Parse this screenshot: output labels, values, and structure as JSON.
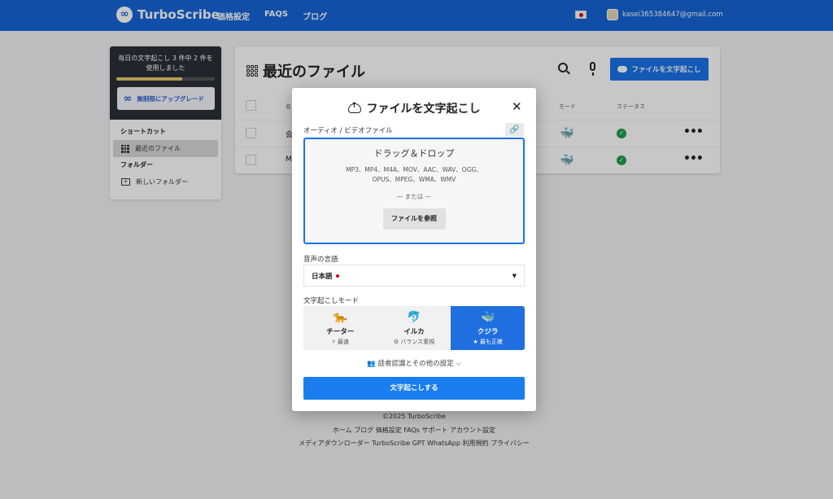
{
  "nav": {
    "brand": "TurboScribe",
    "links": [
      "価格設定",
      "FAQS",
      "ブログ"
    ],
    "email": "kasei365384647@gmail.com"
  },
  "sidebar": {
    "usage_text": "毎日の文字起こし 3 件中 2 件を使用しました",
    "usage_fraction": 0.667,
    "upgrade_label": "無制限にアップグレード",
    "shortcuts_heading": "ショートカット",
    "recent_files": "最近のファイル",
    "folders_heading": "フォルダー",
    "new_folder": "新しいフォルダー"
  },
  "main": {
    "title": "最近のファイル",
    "transcribe_label": "ファイルを文字起こし",
    "columns": {
      "name": "名",
      "mode": "モード",
      "status": "ステータス"
    },
    "rows": [
      {
        "name": "会"
      },
      {
        "name": "M"
      }
    ]
  },
  "footer": {
    "copyright": "©2025 TurboScribe",
    "links1": "ホーム  ブログ  価格設定  FAQs  サポート  アカウント設定",
    "links2": "メディアダウンローダー  TurboScribe GPT  WhatsApp  利用規約  プライバシー"
  },
  "modal": {
    "title": "ファイルを文字起こし",
    "file_label": "オーディオ / ビデオファイル",
    "drop_title": "ドラッグ＆ドロップ",
    "formats": "MP3、MP4、M4A、MOV、AAC、WAV、OGG、OPUS、MPEG、WMA、WMV",
    "or_text": "— または —",
    "browse_label": "ファイルを参照",
    "language_label": "音声の言語",
    "language_value": "日本語",
    "mode_label": "文字起こしモード",
    "modes": [
      {
        "name": "チーター",
        "sub": "⚡ 最速",
        "emoji": "🐆"
      },
      {
        "name": "イルカ",
        "sub": "⚙ バランス重視",
        "emoji": "🐬"
      },
      {
        "name": "クジラ",
        "sub": "★ 最も正確",
        "emoji": "🐳"
      }
    ],
    "speaker_label": "👥 話者認識とその他の設定 ⌵",
    "submit_label": "文字起こしする"
  }
}
